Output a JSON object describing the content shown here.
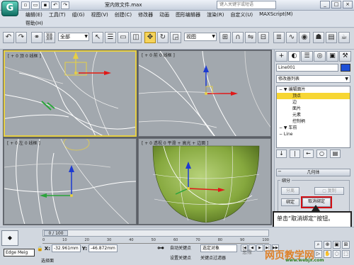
{
  "window": {
    "app_logo": "G",
    "doc_title": "室内效文件.max",
    "search_placeholder": "键入关键字或短语",
    "controls": [
      "_",
      "□",
      "×"
    ]
  },
  "menu": {
    "row1": [
      "编辑(E)",
      "工具(T)",
      "组(G)",
      "视图(V)",
      "创建(C)",
      "修改器",
      "动画",
      "图形编辑器",
      "渲染(R)",
      "自定义(U)",
      "MAXScript(M)"
    ],
    "row2": "帮助(H)"
  },
  "toolbar": {
    "filter_all": "全部",
    "view_ref": "视图",
    "icons": [
      "undo-icon",
      "redo-icon",
      "link-icon",
      "unlink-icon",
      "select-icon",
      "select-name-icon",
      "region-icon",
      "move-icon",
      "rotate-icon",
      "scale-icon",
      "pivot-icon",
      "snap-icon",
      "mirror-icon",
      "align-icon",
      "render-setup-icon",
      "render-icon"
    ]
  },
  "viewports": [
    {
      "label": "[ + 0 顶 0 线框 ]",
      "active": true
    },
    {
      "label": "[ + 0 前 0 线框 ]",
      "active": false
    },
    {
      "label": "[ + 0 左 0 线框 ]",
      "active": false
    },
    {
      "label": "[ + 0 透视 0 平滑 + 高光 + 边面 ]",
      "active": false
    }
  ],
  "command_panel": {
    "tabs": [
      "+",
      "◐",
      "☰",
      "◎",
      "▣",
      "⚒"
    ],
    "object_name": "Line001",
    "object_color": "#1c4fd6",
    "modifier_list": "修改器列表",
    "stack": [
      {
        "label": "− ▼ 编辑面片",
        "selected": false,
        "sub": false
      },
      {
        "label": "顶点",
        "selected": true,
        "sub": true
      },
      {
        "label": "边",
        "selected": false,
        "sub": true
      },
      {
        "label": "面片",
        "selected": false,
        "sub": true
      },
      {
        "label": "元素",
        "selected": false,
        "sub": true
      },
      {
        "label": "控制柄",
        "selected": false,
        "sub": true
      },
      {
        "label": "− ▼ 车前",
        "selected": false,
        "sub": false
      },
      {
        "label": "− Line",
        "selected": false,
        "sub": false
      }
    ],
    "stack_buttons": [
      "↓",
      "|",
      "←",
      "○",
      "▤"
    ],
    "rollout_title": "几何体",
    "rollout_pm": "−",
    "bind_group_title": "绑分",
    "detach_label": "分离",
    "copy_label": "复制",
    "bind_label": "绑定",
    "unbind_label": "取消绑定"
  },
  "callout": {
    "text": "单击“取消绑定”按钮。"
  },
  "status": {
    "max_button": "◆",
    "time_slider": "0 / 100",
    "ruler": [
      "0",
      "10",
      "20",
      "30",
      "40",
      "50",
      "60",
      "70",
      "80",
      "90",
      "100"
    ],
    "maxscript": "Edge Meig",
    "x_label": "X:",
    "x_value": "-32.961mm",
    "y_label": "Y:",
    "y_value": "-46.872mm",
    "selection_status": "选择面",
    "auto_key": "自动关键点",
    "set_key": "设置关键点",
    "selected_object": "选定对象",
    "key_filter": "关键点过滤器",
    "play_buttons": [
      "|◀",
      "◀",
      "▶",
      "▶|",
      "▶▶"
    ],
    "nav_icons": [
      "zoom-icon",
      "zoom-all-icon",
      "extents-icon",
      "pan-icon",
      "orbit-icon",
      "fov-icon",
      "maximize-icon",
      "walk-icon"
    ]
  },
  "watermark": {
    "site": "网页教学网",
    "url": "www.webjx.com",
    "sd": "思缘"
  }
}
